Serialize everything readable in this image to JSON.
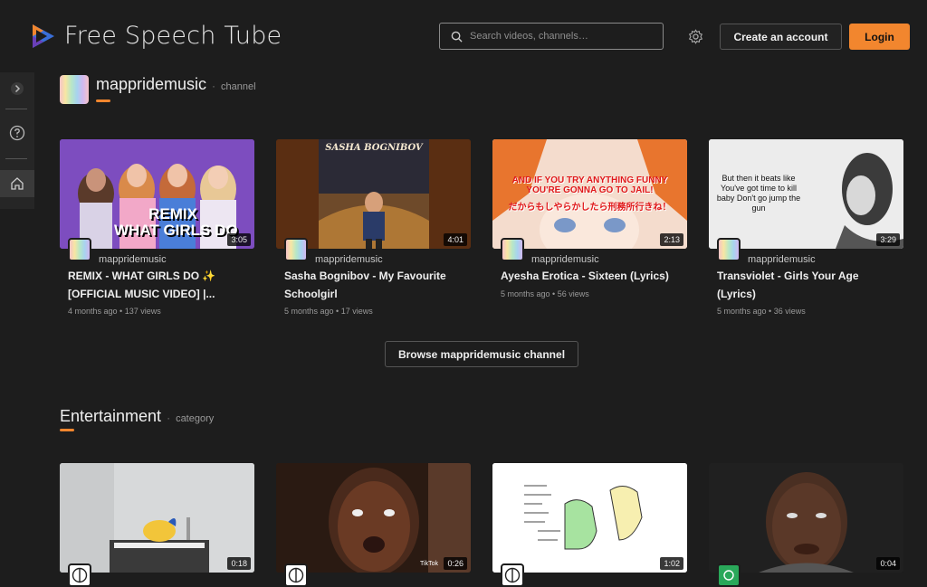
{
  "header": {
    "title": "Free Speech Tube",
    "search_placeholder": "Search videos, channels…",
    "create_account_label": "Create an account",
    "login_label": "Login",
    "accent": "#f2862e"
  },
  "sidebar": {
    "items": [
      {
        "icon": "chevron-right-icon"
      },
      {
        "icon": "help-icon"
      },
      {
        "icon": "home-icon"
      }
    ]
  },
  "channel_section": {
    "title": "mappridemusic",
    "dot": "·",
    "type": "channel",
    "videos": [
      {
        "channel": "mappridemusic",
        "title": "REMIX - WHAT GIRLS DO ✨ [OFFICIAL MUSIC VIDEO] |...",
        "meta": "4 months ago • 137 views",
        "duration": "3:05",
        "thumb_text": "REMIX\nWHAT GIRLS DO"
      },
      {
        "channel": "mappridemusic",
        "title": "Sasha Bognibov - My Favourite Schoolgirl",
        "meta": "5 months ago • 17 views",
        "duration": "4:01",
        "thumb_text": "SASHA BOGNIBOV"
      },
      {
        "channel": "mappridemusic",
        "title": "Ayesha Erotica - Sixteen (Lyrics)",
        "meta": "5 months ago • 56 views",
        "duration": "2:13",
        "thumb_text": "AND IF YOU TRY ANYTHING FUNNY YOU'RE GONNA GO TO JAIL!",
        "thumb_text_jp": "だからもしやらかしたら刑務所行きね！"
      },
      {
        "channel": "mappridemusic",
        "title": "Transviolet - Girls Your Age (Lyrics)",
        "meta": "5 months ago • 36 views",
        "duration": "3:29",
        "thumb_text": "But then it beats like You've got time to kill baby Don't go jump the gun"
      }
    ],
    "browse_label": "Browse mappridemusic channel"
  },
  "category_section": {
    "title": "Entertainment",
    "dot": "·",
    "type": "category",
    "videos": [
      {
        "duration": "0:18"
      },
      {
        "duration": "0:26",
        "watermark": "TikTok"
      },
      {
        "duration": "1:02"
      },
      {
        "duration": "0:04"
      }
    ]
  }
}
